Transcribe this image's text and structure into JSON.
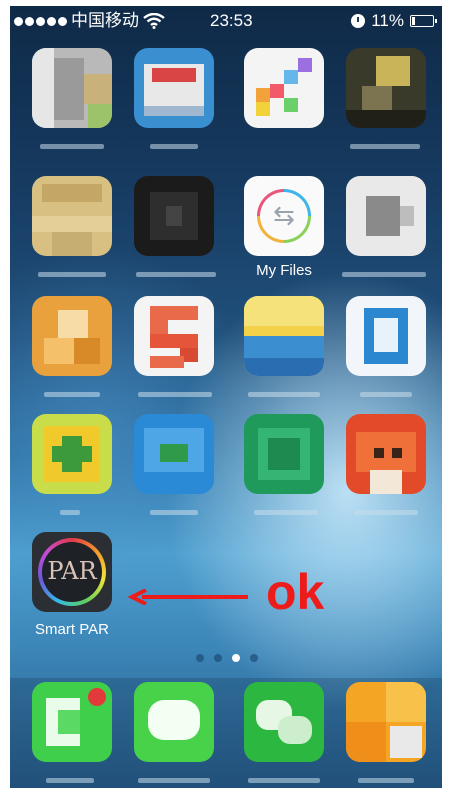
{
  "statusbar": {
    "signal_dots": 5,
    "carrier": "中国移动",
    "time": "23:53",
    "battery": "11%",
    "icons": [
      "signal-dots-icon",
      "wifi-icon",
      "alarm-clock-icon",
      "battery-icon"
    ]
  },
  "apps": {
    "my_files": {
      "label": "My Files"
    },
    "smart_par": {
      "label": "Smart PAR",
      "icon_text": "PAR"
    }
  },
  "annotation": {
    "text": "ok",
    "color": "#ee1b1b"
  },
  "page_indicator": {
    "pages": 4,
    "active_index": 2
  },
  "colors": {
    "accent_red": "#ee1b1b",
    "label_white": "#ffffff"
  }
}
